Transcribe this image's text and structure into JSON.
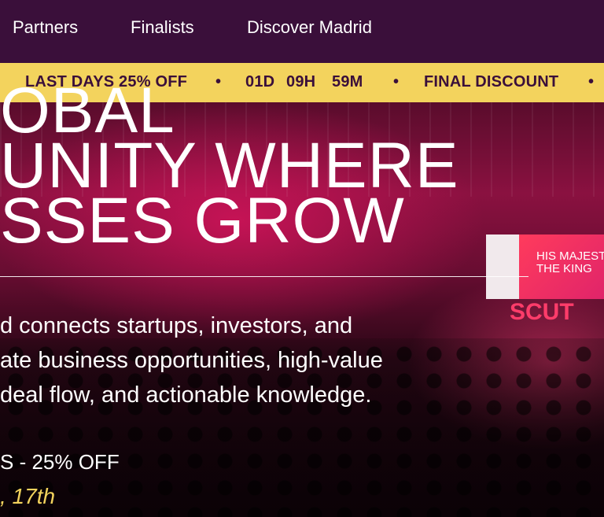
{
  "nav": {
    "links": [
      "Partners",
      "Finalists",
      "Discover Madrid"
    ]
  },
  "ticker": {
    "promo": "LAST DAYS 25% OFF",
    "days": "01D",
    "hours": "09H",
    "minutes": "59M",
    "final": "FINAL DISCOUNT",
    "separator": "•"
  },
  "hero": {
    "headline_lines": [
      "OBAL",
      "UNITY WHERE",
      "SSES GROW"
    ],
    "description_lines": [
      "d connects startups, investors, and",
      "ate business opportunities, high-value",
      "deal flow, and actionable knowledge."
    ],
    "promo_line": "S - 25% OFF",
    "date_line": ", 17th",
    "screen_text": "HIS MAJEST\nTHE KING",
    "stage_sign": "SCUT"
  },
  "colors": {
    "nav_bg": "#3a0f3a",
    "ticker_bg": "#f3d35d",
    "ticker_text": "#3a0f3a",
    "accent_yellow": "#f3d35d"
  }
}
